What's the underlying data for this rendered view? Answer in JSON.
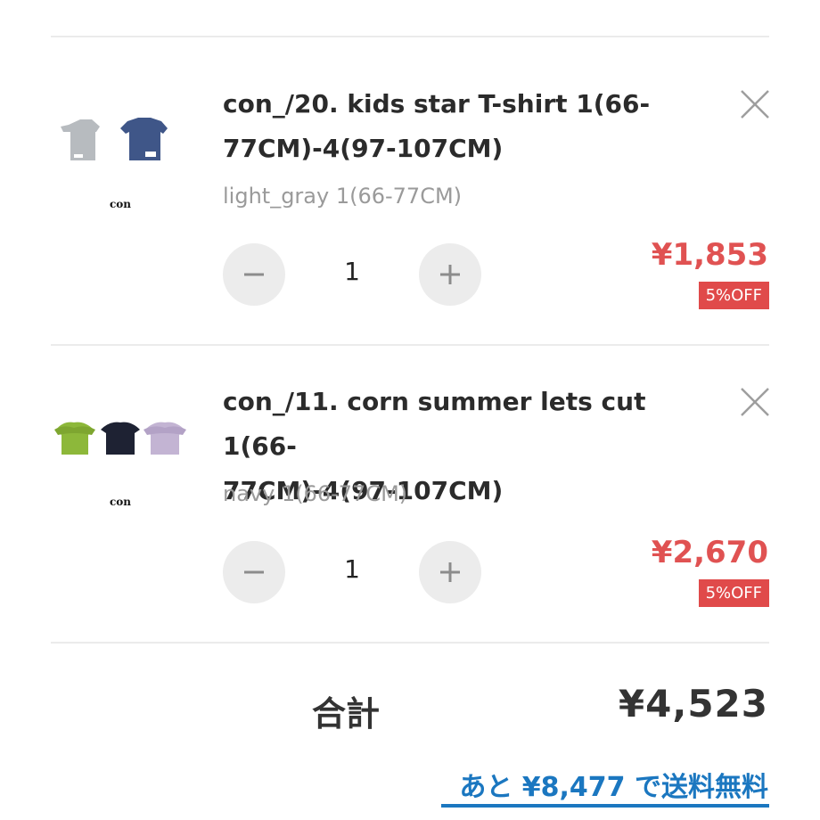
{
  "cart": {
    "items": [
      {
        "name_line1": "con_/20. kids star T-shirt 1(66-",
        "name_line2": "77CM)-4(97-107CM)",
        "variant": "light_gray 1(66-77CM)",
        "quantity": "1",
        "price": "¥1,853",
        "discount_badge": "5%OFF",
        "thumbnail_brand": "con"
      },
      {
        "name_line1": "con_/11. corn summer lets cut 1(66-",
        "name_line2": "77CM)-4(97-107CM)",
        "variant": "navy 1(66-77CM)",
        "quantity": "1",
        "price": "¥2,670",
        "discount_badge": "5%OFF",
        "thumbnail_brand": "con"
      }
    ],
    "total_label": "合計",
    "total_value": "¥4,523",
    "free_shipping_text": "あと ¥8,477 で送料無料"
  },
  "icons": {
    "remove": "close-icon",
    "decrement": "minus-icon",
    "increment": "plus-icon"
  },
  "colors": {
    "price": "#e05252",
    "badge": "#e04a4a",
    "link": "#1b77c0",
    "quantity_button": "#ececec"
  }
}
